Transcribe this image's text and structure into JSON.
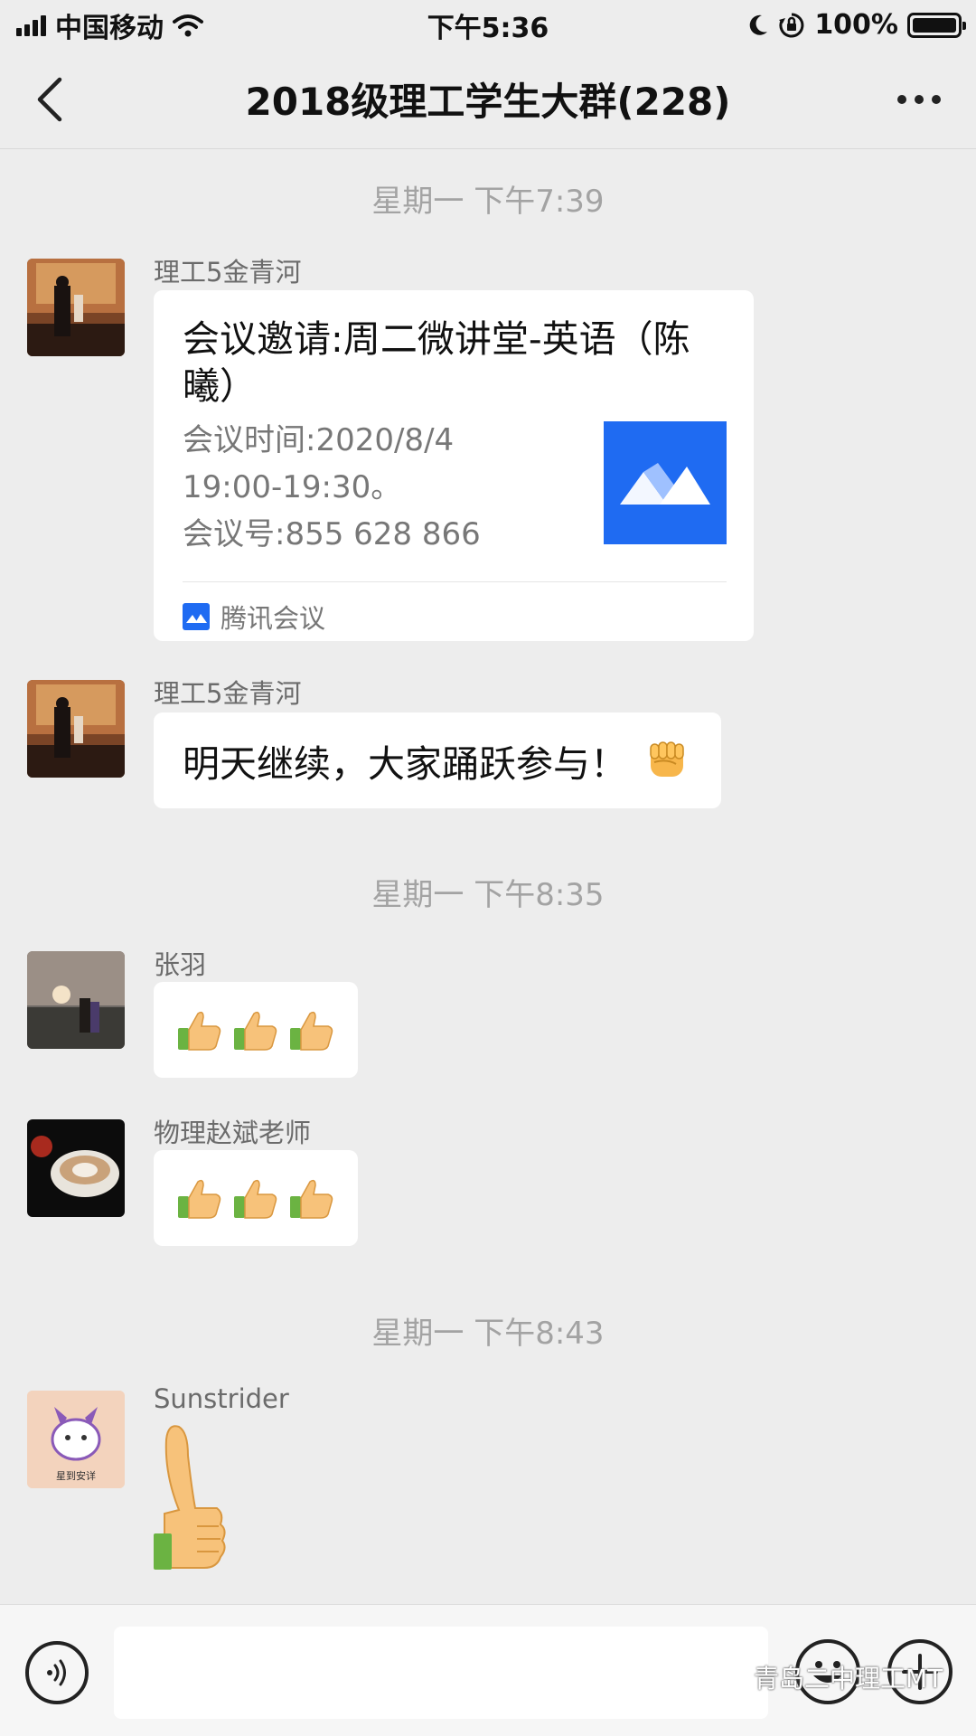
{
  "status_bar": {
    "carrier": "中国移动",
    "time": "下午5:36",
    "battery": "100%",
    "icons": [
      "signal-icon",
      "wifi-icon",
      "moon-icon",
      "rotation-lock-icon",
      "battery-icon"
    ]
  },
  "header": {
    "title": "2018级理工学生大群(228)",
    "back_icon": "chevron-left-icon",
    "more_icon": "more-dots-icon"
  },
  "messages": [
    {
      "type": "time",
      "text": "星期一 下午7:39"
    },
    {
      "type": "meeting_card",
      "sender": "理工5金青河",
      "title": "会议邀请:周二微讲堂-英语（陈曦）",
      "details": [
        "会议时间:2020/8/4",
        "19:00-19:30。",
        "会议号:855 628 866"
      ],
      "source": "腾讯会议",
      "accent_color": "#1f6bf2"
    },
    {
      "type": "text",
      "sender": "理工5金青河",
      "text": "明天继续，大家踊跃参与！",
      "emoji": "raised-fist-emoji"
    },
    {
      "type": "time",
      "text": "星期一 下午8:35"
    },
    {
      "type": "emoji",
      "sender": "张羽",
      "emojis": [
        "thumbs-up-emoji",
        "thumbs-up-emoji",
        "thumbs-up-emoji"
      ]
    },
    {
      "type": "emoji",
      "sender": "物理赵斌老师",
      "emojis": [
        "thumbs-up-emoji",
        "thumbs-up-emoji",
        "thumbs-up-emoji"
      ]
    },
    {
      "type": "time",
      "text": "星期一 下午8:43"
    },
    {
      "type": "sticker",
      "sender": "Sunstrider",
      "sticker": "thumbs-up-sticker"
    }
  ],
  "avatar_sticker_text": "星到安详",
  "bottom_bar": {
    "input_value": "",
    "icons": [
      "voice-icon",
      "emoji-icon",
      "plus-icon"
    ]
  },
  "watermark": "青岛二中理工MT",
  "colors": {
    "background": "#ededed",
    "bubble": "#ffffff",
    "tencent_meeting_blue": "#1f6bf2"
  }
}
